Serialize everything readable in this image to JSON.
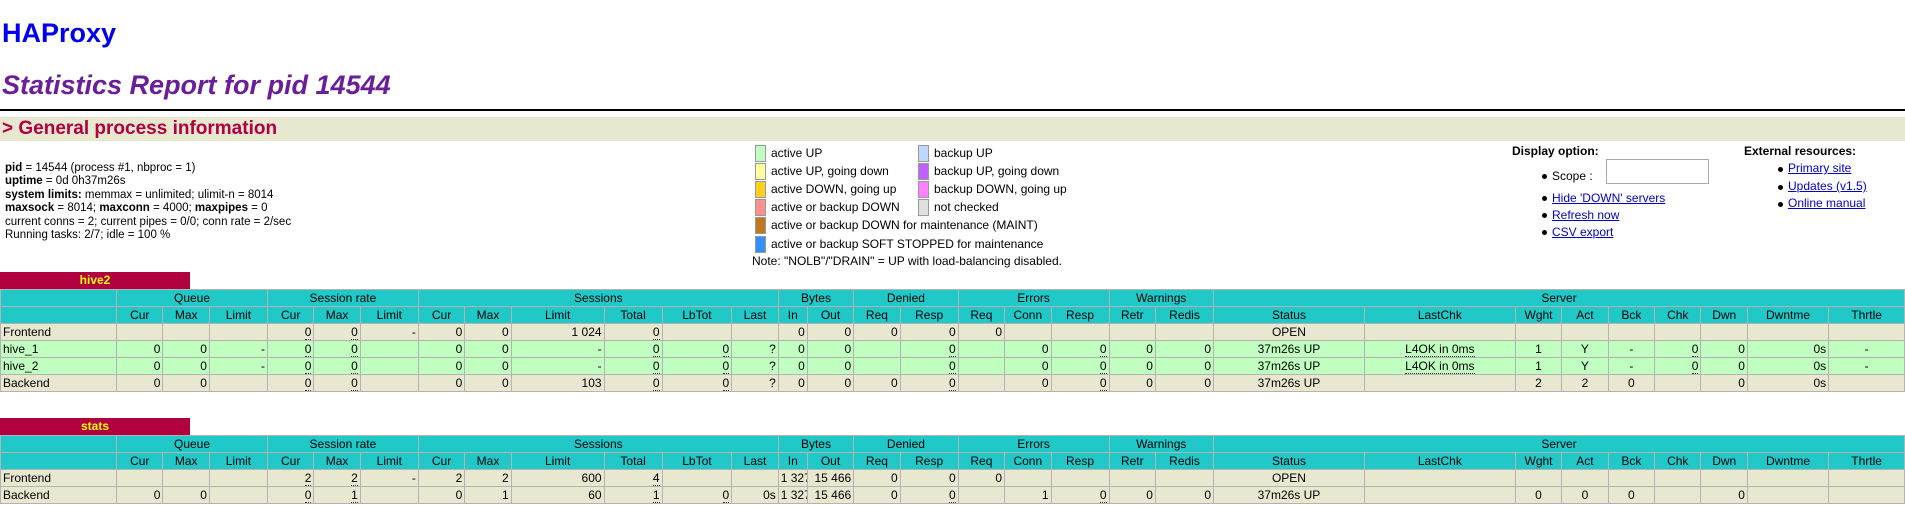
{
  "header": {
    "title": "HAProxy",
    "subtitle": "Statistics Report for pid 14544"
  },
  "section": {
    "general": "> General process information"
  },
  "info": {
    "pid_label": "pid",
    "pid_value": " = 14544 (process #1, nbproc = 1)",
    "uptime_label": "uptime",
    "uptime_value": " = 0d 0h37m26s",
    "syslimits_label": "system limits:",
    "syslimits_value": " memmax = unlimited; ulimit-n = 8014",
    "maxsock_label": "maxsock",
    "maxsock_value": " = 8014; ",
    "maxconn_label": "maxconn",
    "maxconn_value": " = 4000; ",
    "maxpipes_label": "maxpipes",
    "maxpipes_value": " = 0",
    "conns": "current conns = 2; current pipes = 0/0; conn rate = 2/sec",
    "tasks": "Running tasks: 2/7; idle = 100 %"
  },
  "legend": {
    "items": [
      {
        "label": "active UP",
        "color": "#c0ffc0"
      },
      {
        "label": "active UP, going down",
        "color": "#ffffa0"
      },
      {
        "label": "active DOWN, going up",
        "color": "#ffd020"
      },
      {
        "label": "active or backup DOWN",
        "color": "#ff9090"
      },
      {
        "label": "active or backup DOWN for maintenance (MAINT)",
        "color": "#c07820"
      },
      {
        "label": "active or backup SOFT STOPPED for maintenance",
        "color": "#3090ff"
      },
      {
        "label": "backup UP",
        "color": "#c0d8ff"
      },
      {
        "label": "backup UP, going down",
        "color": "#c060ff"
      },
      {
        "label": "backup DOWN, going up",
        "color": "#ff80ff"
      },
      {
        "label": "not checked",
        "color": "#e0e0e0"
      }
    ],
    "note": "Note: \"NOLB\"/\"DRAIN\" = UP with load-balancing disabled."
  },
  "display": {
    "title": "Display option:",
    "scope_label": "Scope :",
    "scope_value": "",
    "hide_down": "Hide 'DOWN' servers",
    "refresh": "Refresh now",
    "csv": "CSV export"
  },
  "external": {
    "title": "External resources:",
    "primary": "Primary site",
    "updates": "Updates (v1.5)",
    "manual": "Online manual"
  },
  "groups": [
    "Queue",
    "Session rate",
    "Sessions",
    "Bytes",
    "Denied",
    "Errors",
    "Warnings",
    "Server"
  ],
  "columns": [
    "",
    "Cur",
    "Max",
    "Limit",
    "Cur",
    "Max",
    "Limit",
    "Cur",
    "Max",
    "Limit",
    "Total",
    "LbTot",
    "Last",
    "In",
    "Out",
    "Req",
    "Resp",
    "Req",
    "Conn",
    "Resp",
    "Retr",
    "Redis",
    "Status",
    "LastChk",
    "Wght",
    "Act",
    "Bck",
    "Chk",
    "Dwn",
    "Dwntme",
    "Thrtle"
  ],
  "proxies": [
    {
      "name": "hive2",
      "rows": [
        {
          "type": "fe",
          "cells": [
            "Frontend",
            "",
            "",
            "",
            "0",
            "0",
            "-",
            "0",
            "0",
            "1 024",
            "0",
            "",
            "",
            "0",
            "0",
            "0",
            "0",
            "0",
            "",
            "",
            "",
            "",
            "OPEN",
            "",
            "",
            "",
            "",
            "",
            "",
            "",
            ""
          ]
        },
        {
          "type": "sv",
          "cells": [
            "hive_1",
            "0",
            "0",
            "-",
            "0",
            "0",
            "",
            "0",
            "0",
            "-",
            "0",
            "0",
            "?",
            "0",
            "0",
            "",
            "0",
            "",
            "0",
            "0",
            "0",
            "0",
            "37m26s UP",
            "L4OK in 0ms",
            "1",
            "Y",
            "-",
            "0",
            "0",
            "0s",
            "-"
          ]
        },
        {
          "type": "sv",
          "cells": [
            "hive_2",
            "0",
            "0",
            "-",
            "0",
            "0",
            "",
            "0",
            "0",
            "-",
            "0",
            "0",
            "?",
            "0",
            "0",
            "",
            "0",
            "",
            "0",
            "0",
            "0",
            "0",
            "37m26s UP",
            "L4OK in 0ms",
            "1",
            "Y",
            "-",
            "0",
            "0",
            "0s",
            "-"
          ]
        },
        {
          "type": "be",
          "cells": [
            "Backend",
            "0",
            "0",
            "",
            "0",
            "0",
            "",
            "0",
            "0",
            "103",
            "0",
            "0",
            "?",
            "0",
            "0",
            "0",
            "0",
            "",
            "0",
            "0",
            "0",
            "0",
            "37m26s UP",
            "",
            "2",
            "2",
            "0",
            "",
            "0",
            "0s",
            ""
          ]
        }
      ]
    },
    {
      "name": "stats",
      "rows": [
        {
          "type": "fe",
          "cells": [
            "Frontend",
            "",
            "",
            "",
            "2",
            "2",
            "-",
            "2",
            "2",
            "600",
            "4",
            "",
            "",
            "1 327",
            "15 466",
            "0",
            "0",
            "0",
            "",
            "",
            "",
            "",
            "OPEN",
            "",
            "",
            "",
            "",
            "",
            "",
            "",
            ""
          ]
        },
        {
          "type": "be",
          "cells": [
            "Backend",
            "0",
            "0",
            "",
            "0",
            "1",
            "",
            "0",
            "1",
            "60",
            "1",
            "0",
            "0s",
            "1 327",
            "15 466",
            "0",
            "0",
            "",
            "1",
            "0",
            "0",
            "0",
            "37m26s UP",
            "",
            "0",
            "0",
            "0",
            "",
            "0",
            "",
            ""
          ]
        }
      ]
    }
  ]
}
